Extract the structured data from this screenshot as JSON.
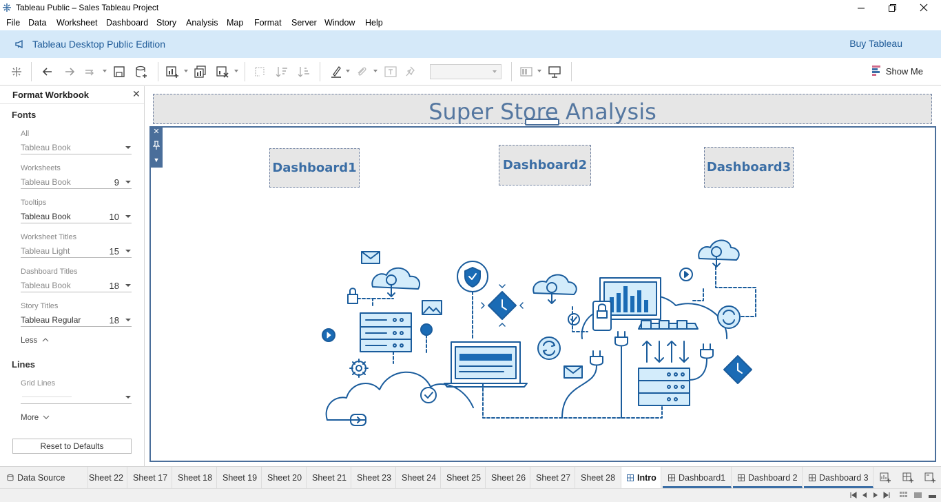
{
  "window": {
    "title": "Tableau Public – Sales Tableau Project",
    "controls": [
      "minimize",
      "restore",
      "close"
    ]
  },
  "menu": [
    "File",
    "Data",
    "Worksheet",
    "Dashboard",
    "Story",
    "Analysis",
    "Map",
    "Format",
    "Server",
    "Window",
    "Help"
  ],
  "banner": {
    "edition": "Tableau Desktop Public Edition",
    "buy": "Buy Tableau"
  },
  "toolbar": {
    "show_me": "Show Me",
    "fit_value": ""
  },
  "format_pane": {
    "title": "Format Workbook",
    "fonts_header": "Fonts",
    "fields": [
      {
        "label": "All",
        "font": "Tableau Book",
        "size": ""
      },
      {
        "label": "Worksheets",
        "font": "Tableau Book",
        "size": "9"
      },
      {
        "label": "Tooltips",
        "font": "Tableau Book",
        "size": "10"
      },
      {
        "label": "Worksheet Titles",
        "font": "Tableau Light",
        "size": "15"
      },
      {
        "label": "Dashboard Titles",
        "font": "Tableau Book",
        "size": "18"
      },
      {
        "label": "Story Titles",
        "font": "Tableau Regular",
        "size": "18"
      }
    ],
    "less_link": "Less",
    "lines_header": "Lines",
    "grid_lines_label": "Grid Lines",
    "more_link": "More",
    "reset_button": "Reset to Defaults"
  },
  "dashboard": {
    "title": "Super Store Analysis",
    "buttons": [
      "Dashboard1",
      "Dashboard2",
      "Dashboard3"
    ]
  },
  "tabs": {
    "data_source": "Data Source",
    "sheets": [
      "Sheet 22",
      "Sheet 17",
      "Sheet 18",
      "Sheet 19",
      "Sheet 20",
      "Sheet 21",
      "Sheet 23",
      "Sheet 24",
      "Sheet 25",
      "Sheet 26",
      "Sheet 27",
      "Sheet 28"
    ],
    "active": "Intro",
    "dashboards": [
      "Dashboard1",
      "Dashboard 2",
      "Dashboard 3"
    ]
  },
  "colors": {
    "banner_bg": "#d5e9f9",
    "accent_blue": "#3b6ea5",
    "title_text": "#5577a0",
    "illustration_blue": "#1a6bb5",
    "illustration_light": "#d3ecfb"
  }
}
